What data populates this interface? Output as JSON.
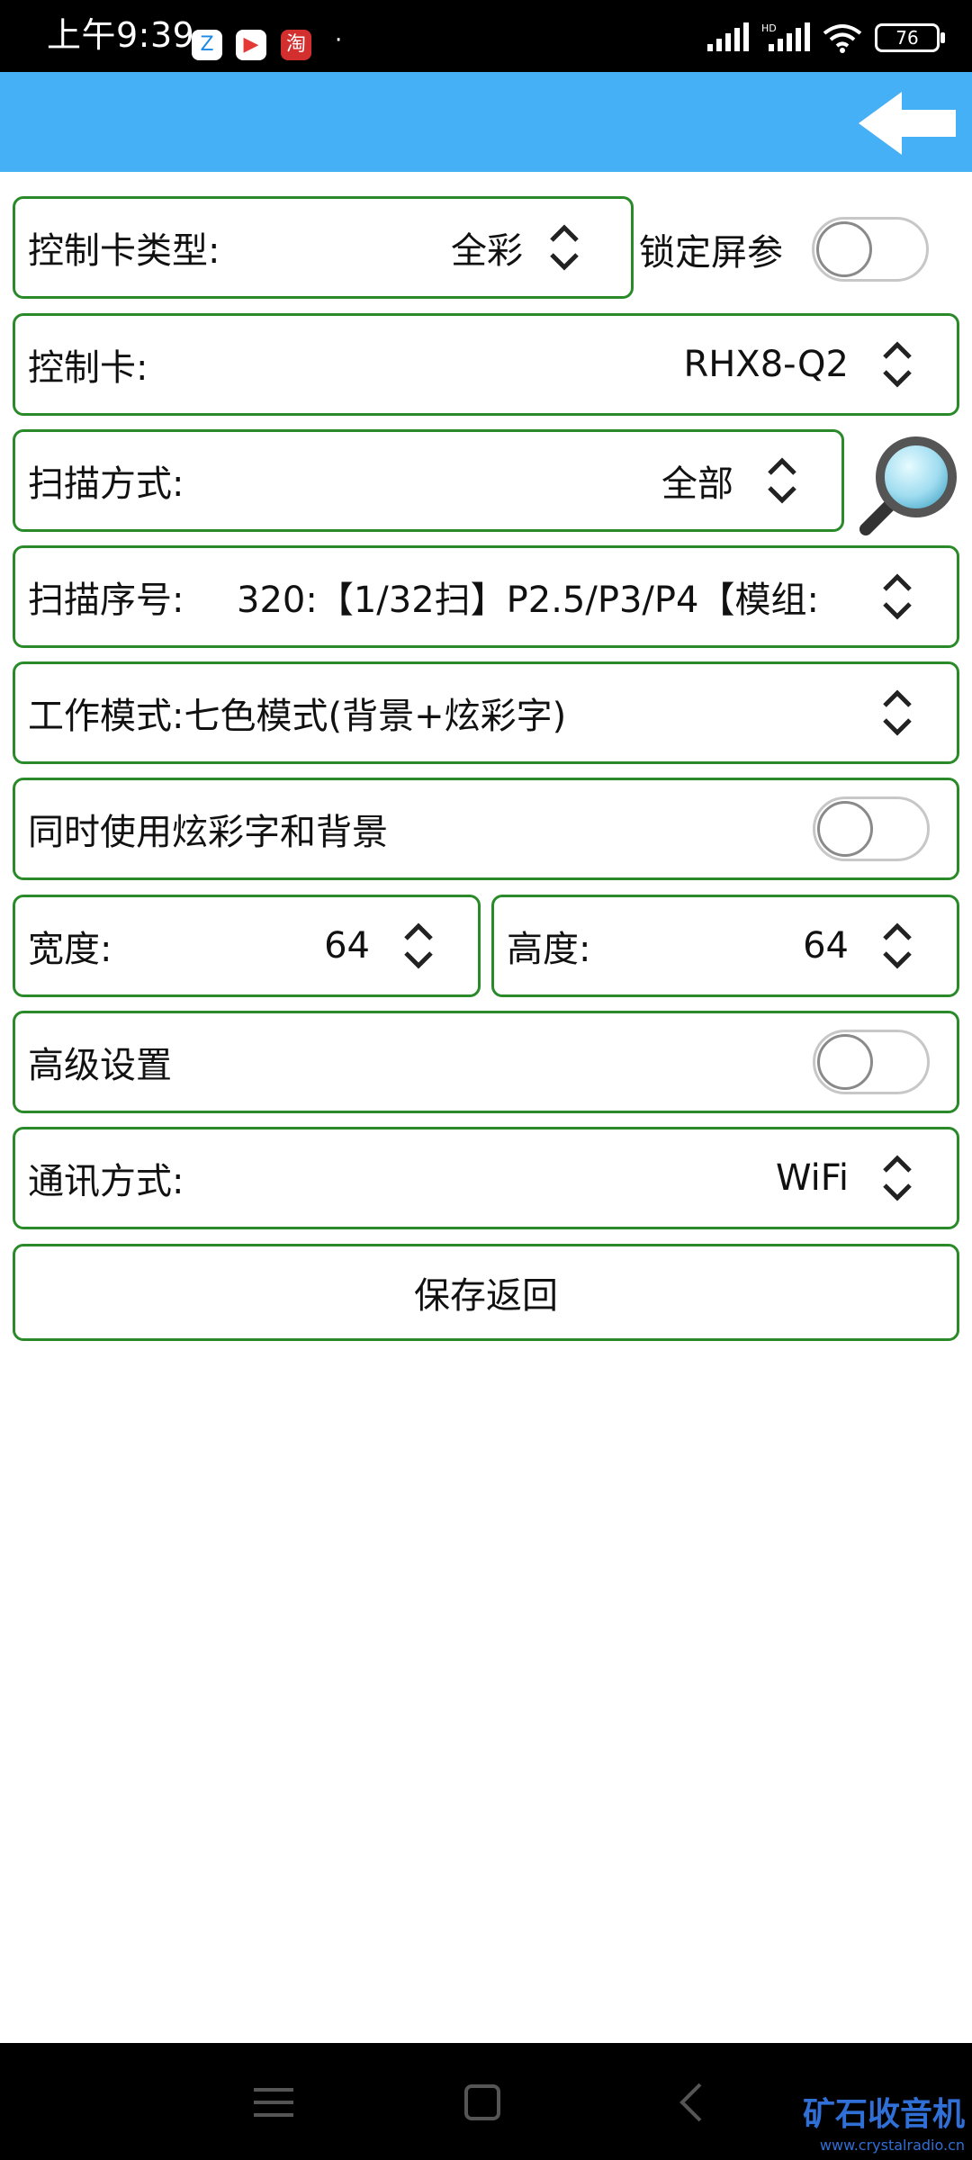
{
  "status_bar": {
    "time": "上午9:39",
    "app_icons": [
      {
        "icon": "app-blue-icon",
        "color": "#1e88e5",
        "glyph": "Z"
      },
      {
        "icon": "app-red-icon",
        "color": "#e53935",
        "glyph": "▶"
      },
      {
        "icon": "taobao-icon",
        "color": "#d32f2f",
        "glyph": "淘"
      }
    ],
    "dot": "·",
    "battery": "76"
  },
  "header": {
    "background": "#45b0f5",
    "back_icon": "back-arrow-icon"
  },
  "form": {
    "card_type": {
      "label": "控制卡类型:",
      "value": "全彩"
    },
    "lock_screen": {
      "label": "锁定屏参",
      "on": false
    },
    "card": {
      "label": "控制卡:",
      "value": "RHX8-Q2"
    },
    "scan_mode": {
      "label": "扫描方式:",
      "value": "全部"
    },
    "scan_index": {
      "label": "扫描序号:",
      "value": "320:【1/32扫】P2.5/P3/P4【模组:"
    },
    "work_mode": {
      "label": "工作模式:七色模式(背景+炫彩字)"
    },
    "use_both": {
      "label": "同时使用炫彩字和背景",
      "on": false
    },
    "width": {
      "label": "宽度:",
      "value": "64"
    },
    "height": {
      "label": "高度:",
      "value": "64"
    },
    "advanced": {
      "label": "高级设置",
      "on": false
    },
    "comm_mode": {
      "label": "通讯方式:",
      "value": "WiFi"
    },
    "save_label": "保存返回"
  },
  "watermark": {
    "title": "矿石收音机",
    "url": "www.crystalradio.cn"
  },
  "colors": {
    "border": "#2a8a2a",
    "header": "#45b0f5"
  }
}
